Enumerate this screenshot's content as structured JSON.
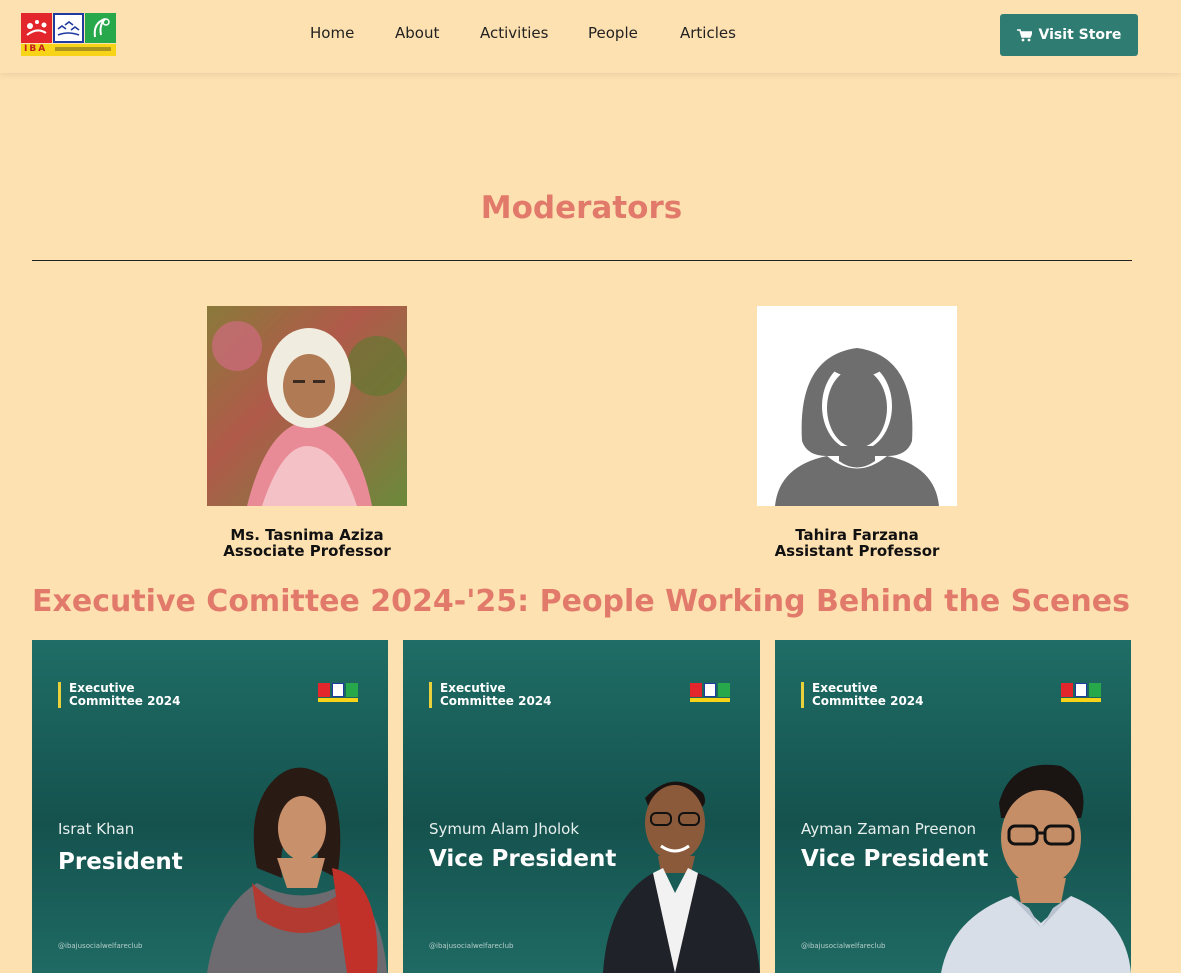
{
  "header": {
    "logo_text": "IBA",
    "nav": [
      {
        "label": "Home"
      },
      {
        "label": "About"
      },
      {
        "label": "Activities"
      },
      {
        "label": "People"
      },
      {
        "label": "Articles"
      }
    ],
    "store_button": "Visit Store"
  },
  "moderators": {
    "title": "Moderators",
    "people": [
      {
        "name": "Ms. Tasnima Aziza",
        "role": "Associate Professor"
      },
      {
        "name": "Tahira Farzana",
        "role": "Assistant Professor"
      }
    ]
  },
  "executive": {
    "title": "Executive Comittee 2024-'25: People Working Behind the Scenes",
    "cards": [
      {
        "badge": "Executive\nCommittee 2024",
        "name": "Israt Khan",
        "position": "President",
        "handle": "@ibajusocialwelfareclub"
      },
      {
        "badge": "Executive\nCommittee 2024",
        "name": "Symum Alam Jholok",
        "position": "Vice President",
        "handle": "@ibajusocialwelfareclub"
      },
      {
        "badge": "Executive\nCommittee 2024",
        "name": "Ayman Zaman Preenon",
        "position": "Vice President",
        "handle": "@ibajusocialwelfareclub"
      }
    ]
  },
  "colors": {
    "background": "#fee1b1",
    "accent": "#e17a6a",
    "button": "#2f7d72",
    "card": "#1f6d66"
  }
}
